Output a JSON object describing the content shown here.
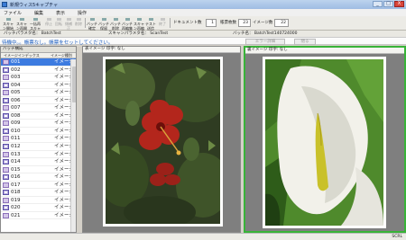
{
  "window": {
    "title": "新規ウィス5キャプチャ",
    "buttons": [
      "_",
      "□",
      "X"
    ]
  },
  "menu": [
    "ファイル",
    "編集",
    "表示",
    "操作"
  ],
  "toolbar": {
    "buttons": [
      {
        "label": "スキャン開始",
        "disabled": false
      },
      {
        "label": "スキャン再開",
        "disabled": false
      },
      {
        "label": "一括再スキャン",
        "disabled": false
      },
      {
        "label": "停止",
        "disabled": true
      },
      {
        "label": "回転",
        "disabled": true
      },
      {
        "label": "傾補正",
        "disabled": true
      },
      {
        "label": "削除",
        "disabled": true
      }
    ],
    "buttons2": [
      {
        "label": "バッチ確定",
        "disabled": false
      },
      {
        "label": "バッチ保留",
        "disabled": false
      },
      {
        "label": "バッチ削除",
        "disabled": false
      },
      {
        "label": "バッチ再編集",
        "disabled": false
      },
      {
        "label": "スキャン再編集",
        "disabled": false
      },
      {
        "label": "テスト送信",
        "disabled": false
      },
      {
        "label": "終了",
        "disabled": true
      }
    ],
    "document_label": "ドキュメント数",
    "document_count": "1",
    "pages_label": "帳票枚数",
    "pages_count": "23",
    "images_label": "イメージ数",
    "images_count": "22"
  },
  "info": {
    "batch_param": "バッチパラメタ名： BatchTest",
    "scan_param": "スキャンパラメタ名： ScanTest",
    "batch_name": "バッチ名： BatchTest140724000"
  },
  "hint": {
    "text": "待機中。。帳票なし。帳票をセットしてください。",
    "error_button": "エラー詳細",
    "close_button": "閉る"
  },
  "left_panel": {
    "header": "バッチ構成",
    "col_index": "イメージインデックス",
    "col_type": "イメージ種別",
    "rows": [
      {
        "num": "001",
        "type": "イメージ"
      },
      {
        "num": "002",
        "type": "イメージ"
      },
      {
        "num": "003",
        "type": "イメージ"
      },
      {
        "num": "004",
        "type": "イメージ"
      },
      {
        "num": "005",
        "type": "イメージ"
      },
      {
        "num": "006",
        "type": "イメージ"
      },
      {
        "num": "007",
        "type": "イメージ"
      },
      {
        "num": "008",
        "type": "イメージ"
      },
      {
        "num": "009",
        "type": "イメージ"
      },
      {
        "num": "010",
        "type": "イメージ"
      },
      {
        "num": "011",
        "type": "イメージ"
      },
      {
        "num": "012",
        "type": "イメージ"
      },
      {
        "num": "013",
        "type": "イメージ"
      },
      {
        "num": "014",
        "type": "イメージ"
      },
      {
        "num": "015",
        "type": "イメージ"
      },
      {
        "num": "016",
        "type": "イメージ"
      },
      {
        "num": "017",
        "type": "イメージ"
      },
      {
        "num": "018",
        "type": "イメージ"
      },
      {
        "num": "019",
        "type": "イメージ"
      },
      {
        "num": "020",
        "type": "イメージ"
      },
      {
        "num": "021",
        "type": "イメージ"
      }
    ],
    "selected_index": 0
  },
  "front_pane": {
    "header": "表イメージ 印字: なし"
  },
  "back_pane": {
    "header": "裏イメージ 印字: なし"
  },
  "status": {
    "text": "SCRL"
  },
  "colors": {
    "selection": "#3c7be0",
    "active_border": "#38b338",
    "hint_text": "#2060c0"
  }
}
